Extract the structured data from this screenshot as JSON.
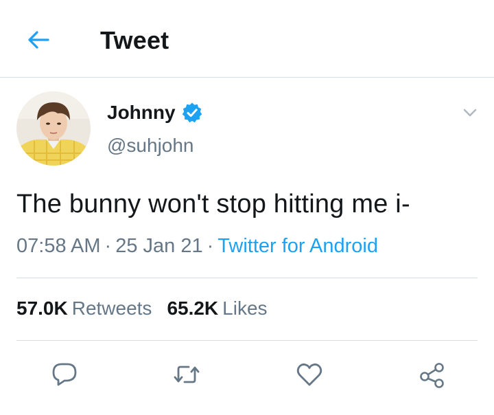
{
  "header": {
    "title": "Tweet",
    "back_icon": "arrow-left-icon",
    "accent": "#1da1f2"
  },
  "tweet": {
    "author": {
      "name": "Johnny",
      "handle": "@suhjohn",
      "verified": true
    },
    "text": "The bunny won't stop hitting me i-",
    "time": "07:58 AM",
    "date": "25 Jan 21",
    "source": "Twitter for Android",
    "retweets": "57.0K",
    "retweets_label": "Retweets",
    "likes": "65.2K",
    "likes_label": "Likes"
  },
  "actions": [
    "reply-icon",
    "retweet-icon",
    "like-icon",
    "share-icon"
  ],
  "colors": {
    "text": "#14171a",
    "secondary": "#657786",
    "link": "#1da1f2",
    "divider": "#d6dde3"
  }
}
